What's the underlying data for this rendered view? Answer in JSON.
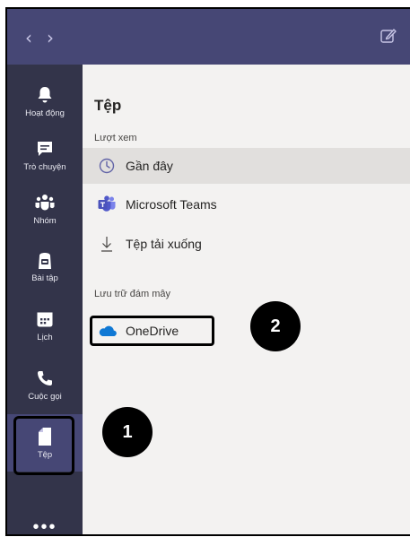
{
  "titlebar": {
    "back_icon": "‹",
    "forward_icon": "›"
  },
  "rail": {
    "items": [
      {
        "label": "Hoạt động",
        "icon": "bell-icon"
      },
      {
        "label": "Trò chuyện",
        "icon": "chat-icon"
      },
      {
        "label": "Nhóm",
        "icon": "teams-icon"
      },
      {
        "label": "Bài tập",
        "icon": "assignments-icon"
      },
      {
        "label": "Lịch",
        "icon": "calendar-icon"
      },
      {
        "label": "Cuộc gọi",
        "icon": "phone-icon"
      },
      {
        "label": "Tệp",
        "icon": "file-icon"
      }
    ],
    "more": "•••"
  },
  "files": {
    "title": "Tệp",
    "views_label": "Lượt xem",
    "views": [
      {
        "label": "Gần đây",
        "icon": "clock-icon",
        "selected": true
      },
      {
        "label": "Microsoft Teams",
        "icon": "teams-icon"
      },
      {
        "label": "Tệp tải xuống",
        "icon": "download-icon"
      }
    ],
    "cloud_label": "Lưu trữ đám mây",
    "cloud": [
      {
        "label": "OneDrive",
        "icon": "onedrive-icon"
      }
    ]
  },
  "annotations": {
    "badge_1": "1",
    "badge_2": "2"
  },
  "colors": {
    "titlebar": "#464775",
    "rail": "#33344a",
    "content_bg": "#f3f2f1",
    "selected_row": "#e1dfdd",
    "accent": "#6264a7",
    "onedrive": "#0f78d4"
  }
}
